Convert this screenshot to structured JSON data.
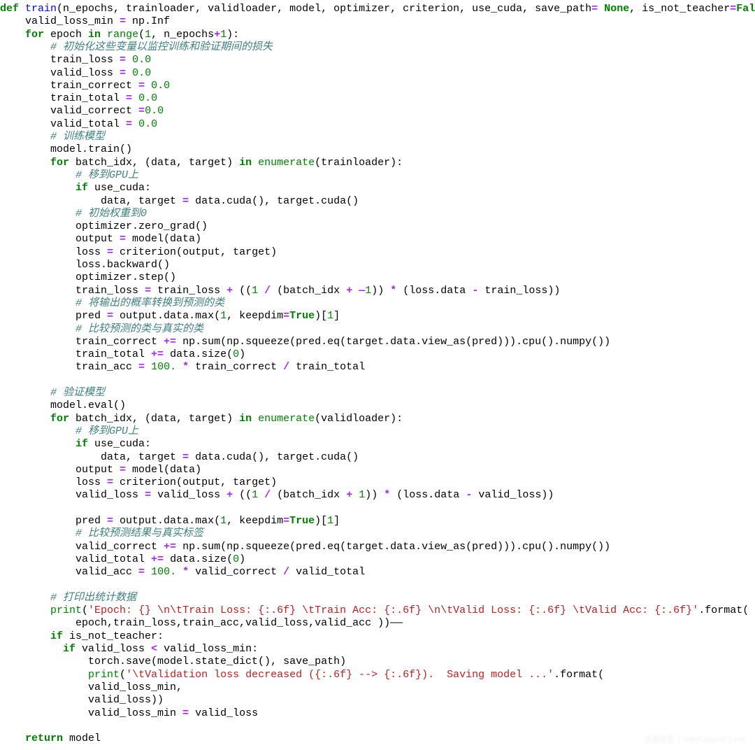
{
  "editor": {
    "language": "python",
    "colors": {
      "keyword": "#008000",
      "function_name": "#0000ff",
      "operator": "#aa22ff",
      "number": "#008000",
      "string": "#ba2121",
      "comment": "#408080",
      "text": "#000000"
    },
    "lines": [
      [
        [
          "kw",
          "def"
        ],
        [
          "p",
          " "
        ],
        [
          "def",
          "train"
        ],
        [
          "p",
          "(n_epochs, trainloader, validloader, model, optimizer, criterion, use_cuda, save_path"
        ],
        [
          "op",
          "="
        ],
        [
          "p",
          " "
        ],
        [
          "kw",
          "None"
        ],
        [
          "p",
          ", is_not_teacher"
        ],
        [
          "op",
          "="
        ],
        [
          "kw",
          "False"
        ],
        [
          "p",
          ")"
        ]
      ],
      [
        [
          "p",
          "    valid_loss_min "
        ],
        [
          "op",
          "="
        ],
        [
          "p",
          " np.Inf"
        ]
      ],
      [
        [
          "p",
          "    "
        ],
        [
          "kw",
          "for"
        ],
        [
          "p",
          " epoch "
        ],
        [
          "kw",
          "in"
        ],
        [
          "p",
          " "
        ],
        [
          "bi",
          "range"
        ],
        [
          "p",
          "("
        ],
        [
          "num",
          "1"
        ],
        [
          "p",
          ", n_epochs"
        ],
        [
          "op",
          "+"
        ],
        [
          "num",
          "1"
        ],
        [
          "p",
          "):"
        ]
      ],
      [
        [
          "p",
          "        "
        ],
        [
          "cm",
          "# 初始化这些变量以监控训练和验证期间的损失"
        ]
      ],
      [
        [
          "p",
          "        train_loss "
        ],
        [
          "op",
          "="
        ],
        [
          "p",
          " "
        ],
        [
          "num",
          "0.0"
        ]
      ],
      [
        [
          "p",
          "        valid_loss "
        ],
        [
          "op",
          "="
        ],
        [
          "p",
          " "
        ],
        [
          "num",
          "0.0"
        ]
      ],
      [
        [
          "p",
          "        train_correct "
        ],
        [
          "op",
          "="
        ],
        [
          "p",
          " "
        ],
        [
          "num",
          "0.0"
        ]
      ],
      [
        [
          "p",
          "        train_total "
        ],
        [
          "op",
          "="
        ],
        [
          "p",
          " "
        ],
        [
          "num",
          "0.0"
        ]
      ],
      [
        [
          "p",
          "        valid_correct "
        ],
        [
          "op",
          "="
        ],
        [
          "num",
          "0.0"
        ]
      ],
      [
        [
          "p",
          "        valid_total "
        ],
        [
          "op",
          "="
        ],
        [
          "p",
          " "
        ],
        [
          "num",
          "0.0"
        ]
      ],
      [
        [
          "p",
          "        "
        ],
        [
          "cm",
          "# 训练模型"
        ]
      ],
      [
        [
          "p",
          "        model.train()"
        ]
      ],
      [
        [
          "p",
          "        "
        ],
        [
          "kw",
          "for"
        ],
        [
          "p",
          " batch_idx, (data, target) "
        ],
        [
          "kw",
          "in"
        ],
        [
          "p",
          " "
        ],
        [
          "bi",
          "enumerate"
        ],
        [
          "p",
          "(trainloader):"
        ]
      ],
      [
        [
          "p",
          "            "
        ],
        [
          "cm",
          "# 移到GPU上"
        ]
      ],
      [
        [
          "p",
          "            "
        ],
        [
          "kw",
          "if"
        ],
        [
          "p",
          " use_cuda:"
        ]
      ],
      [
        [
          "p",
          "                data, target "
        ],
        [
          "op",
          "="
        ],
        [
          "p",
          " data.cuda(), target.cuda()"
        ]
      ],
      [
        [
          "p",
          "            "
        ],
        [
          "cm",
          "# 初始权重到0"
        ]
      ],
      [
        [
          "p",
          "            optimizer.zero_grad()"
        ]
      ],
      [
        [
          "p",
          "            output "
        ],
        [
          "op",
          "="
        ],
        [
          "p",
          " model(data)"
        ]
      ],
      [
        [
          "p",
          "            loss "
        ],
        [
          "op",
          "="
        ],
        [
          "p",
          " criterion(output, target)"
        ]
      ],
      [
        [
          "p",
          "            loss.backward()"
        ]
      ],
      [
        [
          "p",
          "            optimizer.step()"
        ]
      ],
      [
        [
          "p",
          "            train_loss "
        ],
        [
          "op",
          "="
        ],
        [
          "p",
          " train_loss "
        ],
        [
          "op",
          "+"
        ],
        [
          "p",
          " (("
        ],
        [
          "num",
          "1"
        ],
        [
          "p",
          " "
        ],
        [
          "op",
          "/"
        ],
        [
          "p",
          " (batch_idx "
        ],
        [
          "op",
          "+"
        ],
        [
          "p",
          " "
        ],
        [
          "op",
          "—"
        ],
        [
          "num",
          "1"
        ],
        [
          "p",
          ")) "
        ],
        [
          "op",
          "*"
        ],
        [
          "p",
          " (loss.data "
        ],
        [
          "op",
          "-"
        ],
        [
          "p",
          " train_loss))"
        ]
      ],
      [
        [
          "p",
          "            "
        ],
        [
          "cm",
          "# 将输出的概率转换到预测的类"
        ]
      ],
      [
        [
          "p",
          "            pred "
        ],
        [
          "op",
          "="
        ],
        [
          "p",
          " output.data.max("
        ],
        [
          "num",
          "1"
        ],
        [
          "p",
          ", keepdim"
        ],
        [
          "op",
          "="
        ],
        [
          "kw",
          "True"
        ],
        [
          "p",
          ")["
        ],
        [
          "num",
          "1"
        ],
        [
          "p",
          "]"
        ]
      ],
      [
        [
          "p",
          "            "
        ],
        [
          "cm",
          "# 比较预测的类与真实的类"
        ]
      ],
      [
        [
          "p",
          "            train_correct "
        ],
        [
          "op",
          "+="
        ],
        [
          "p",
          " np.sum(np.squeeze(pred.eq(target.data.view_as(pred))).cpu().numpy())"
        ]
      ],
      [
        [
          "p",
          "            train_total "
        ],
        [
          "op",
          "+="
        ],
        [
          "p",
          " data.size("
        ],
        [
          "num",
          "0"
        ],
        [
          "p",
          ")"
        ]
      ],
      [
        [
          "p",
          "            train_acc "
        ],
        [
          "op",
          "="
        ],
        [
          "p",
          " "
        ],
        [
          "num",
          "100."
        ],
        [
          "p",
          " "
        ],
        [
          "op",
          "*"
        ],
        [
          "p",
          " train_correct "
        ],
        [
          "op",
          "/"
        ],
        [
          "p",
          " train_total"
        ]
      ],
      [],
      [
        [
          "p",
          "        "
        ],
        [
          "cm",
          "# 验证模型"
        ]
      ],
      [
        [
          "p",
          "        model.eval()"
        ]
      ],
      [
        [
          "p",
          "        "
        ],
        [
          "kw",
          "for"
        ],
        [
          "p",
          " batch_idx, (data, target) "
        ],
        [
          "kw",
          "in"
        ],
        [
          "p",
          " "
        ],
        [
          "bi",
          "enumerate"
        ],
        [
          "p",
          "(validloader):"
        ]
      ],
      [
        [
          "p",
          "            "
        ],
        [
          "cm",
          "# 移到GPU上"
        ]
      ],
      [
        [
          "p",
          "            "
        ],
        [
          "kw",
          "if"
        ],
        [
          "p",
          " use_cuda:"
        ]
      ],
      [
        [
          "p",
          "                data, target "
        ],
        [
          "op",
          "="
        ],
        [
          "p",
          " data.cuda(), target.cuda()"
        ]
      ],
      [
        [
          "p",
          "            output "
        ],
        [
          "op",
          "="
        ],
        [
          "p",
          " model(data)"
        ]
      ],
      [
        [
          "p",
          "            loss "
        ],
        [
          "op",
          "="
        ],
        [
          "p",
          " criterion(output, target)"
        ]
      ],
      [
        [
          "p",
          "            valid_loss "
        ],
        [
          "op",
          "="
        ],
        [
          "p",
          " valid_loss "
        ],
        [
          "op",
          "+"
        ],
        [
          "p",
          " (("
        ],
        [
          "num",
          "1"
        ],
        [
          "p",
          " "
        ],
        [
          "op",
          "/"
        ],
        [
          "p",
          " (batch_idx "
        ],
        [
          "op",
          "+"
        ],
        [
          "p",
          " "
        ],
        [
          "num",
          "1"
        ],
        [
          "p",
          ")) "
        ],
        [
          "op",
          "*"
        ],
        [
          "p",
          " (loss.data "
        ],
        [
          "op",
          "-"
        ],
        [
          "p",
          " valid_loss))"
        ]
      ],
      [],
      [
        [
          "p",
          "            pred "
        ],
        [
          "op",
          "="
        ],
        [
          "p",
          " output.data.max("
        ],
        [
          "num",
          "1"
        ],
        [
          "p",
          ", keepdim"
        ],
        [
          "op",
          "="
        ],
        [
          "kw",
          "True"
        ],
        [
          "p",
          ")["
        ],
        [
          "num",
          "1"
        ],
        [
          "p",
          "]"
        ]
      ],
      [
        [
          "p",
          "            "
        ],
        [
          "cm",
          "# 比较预测结果与真实标签"
        ]
      ],
      [
        [
          "p",
          "            valid_correct "
        ],
        [
          "op",
          "+="
        ],
        [
          "p",
          " np.sum(np.squeeze(pred.eq(target.data.view_as(pred))).cpu().numpy())"
        ]
      ],
      [
        [
          "p",
          "            valid_total "
        ],
        [
          "op",
          "+="
        ],
        [
          "p",
          " data.size("
        ],
        [
          "num",
          "0"
        ],
        [
          "p",
          ")"
        ]
      ],
      [
        [
          "p",
          "            valid_acc "
        ],
        [
          "op",
          "="
        ],
        [
          "p",
          " "
        ],
        [
          "num",
          "100."
        ],
        [
          "p",
          " "
        ],
        [
          "op",
          "*"
        ],
        [
          "p",
          " valid_correct "
        ],
        [
          "op",
          "/"
        ],
        [
          "p",
          " valid_total"
        ]
      ],
      [],
      [
        [
          "p",
          "        "
        ],
        [
          "cm",
          "# 打印出统计数据"
        ]
      ],
      [
        [
          "p",
          "        "
        ],
        [
          "bi",
          "print"
        ],
        [
          "p",
          "("
        ],
        [
          "str",
          "'Epoch: {} \\n\\tTrain Loss: {:.6f} \\tTrain Acc: {:.6f} \\n\\tValid Loss: {:.6f} \\tValid Acc: {:.6f}'"
        ],
        [
          "p",
          ".format("
        ]
      ],
      [
        [
          "p",
          "            epoch,train_loss,train_acc,valid_loss,valid_acc ))——"
        ]
      ],
      [
        [
          "p",
          "        "
        ],
        [
          "kw",
          "if"
        ],
        [
          "p",
          " is_not_teacher:"
        ]
      ],
      [
        [
          "p",
          "          "
        ],
        [
          "kw",
          "if"
        ],
        [
          "p",
          " valid_loss "
        ],
        [
          "op",
          "<"
        ],
        [
          "p",
          " valid_loss_min:"
        ]
      ],
      [
        [
          "p",
          "              torch.save(model.state_dict(), save_path)"
        ]
      ],
      [
        [
          "p",
          "              "
        ],
        [
          "bi",
          "print"
        ],
        [
          "p",
          "("
        ],
        [
          "str",
          "'\\tValidation loss decreased ({:.6f} --> {:.6f}).  Saving model ...'"
        ],
        [
          "p",
          ".format("
        ]
      ],
      [
        [
          "p",
          "              valid_loss_min,"
        ]
      ],
      [
        [
          "p",
          "              valid_loss))"
        ]
      ],
      [
        [
          "p",
          "              valid_loss_min "
        ],
        [
          "op",
          "="
        ],
        [
          "p",
          " valid_loss"
        ]
      ],
      [],
      [
        [
          "p",
          "    "
        ],
        [
          "kw",
          "return"
        ],
        [
          "p",
          " model"
        ]
      ]
    ]
  },
  "watermark": {
    "text": "云栖社区 | www.aliyun.com"
  }
}
